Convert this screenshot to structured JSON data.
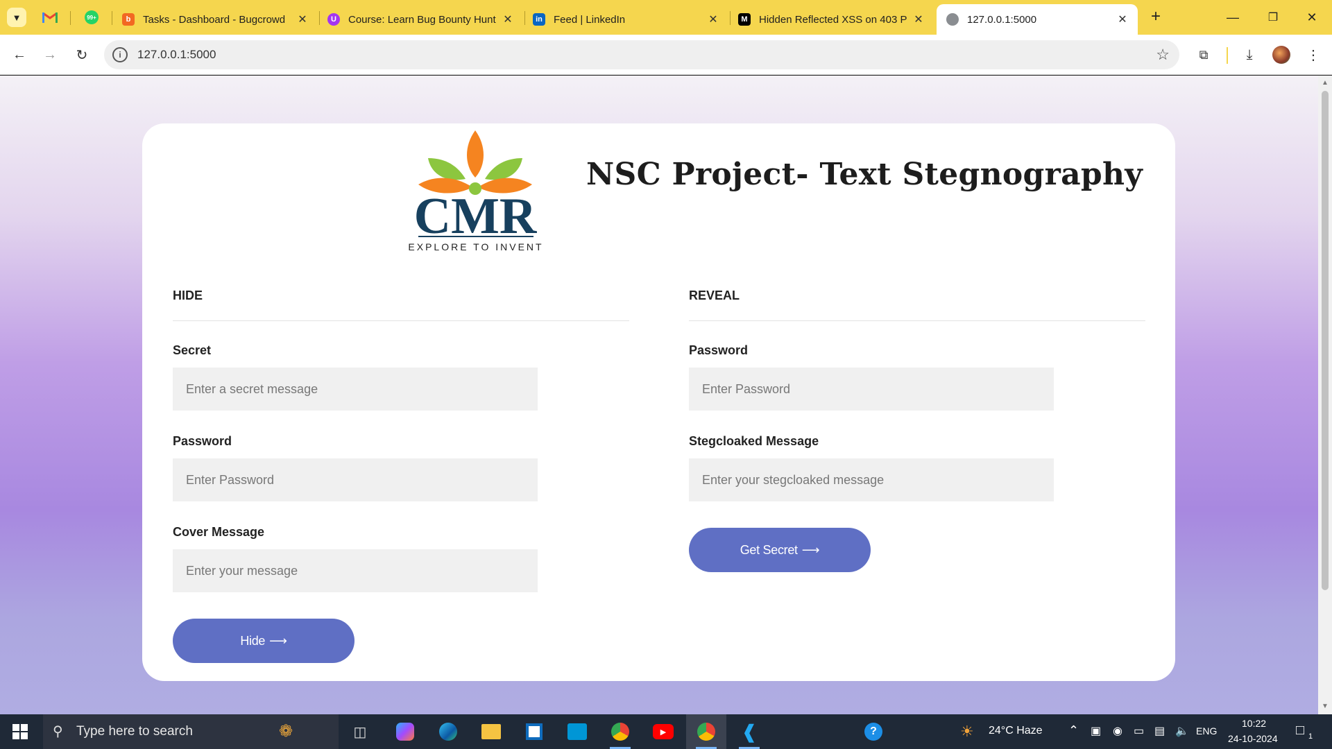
{
  "browser": {
    "tabs": [
      {
        "title": "Tasks - Dashboard - Bugcrowd",
        "favicon": "bugcrowd-icon",
        "color": "#f26822"
      },
      {
        "title": "Course: Learn Bug Bounty Hunt",
        "favicon": "udemy-icon",
        "color": "#a435f0"
      },
      {
        "title": "Feed | LinkedIn",
        "favicon": "linkedin-icon",
        "color": "#0a66c2"
      },
      {
        "title": "Hidden Reflected XSS on 403 P",
        "favicon": "medium-icon",
        "color": "#000000"
      },
      {
        "title": "127.0.0.1:5000",
        "favicon": "globe-icon",
        "color": "#5f6368"
      }
    ],
    "pinned": [
      {
        "name": "gmail-icon",
        "badge": ""
      },
      {
        "name": "whatsapp-icon",
        "badge": "99+"
      }
    ],
    "address": "127.0.0.1:5000",
    "accent_color": "#f5d64e"
  },
  "page": {
    "logo": {
      "letters": "CMR",
      "tagline": "EXPLORE TO INVENT"
    },
    "title": "NSC Project- Text Stegnography",
    "hide": {
      "heading": "HIDE",
      "secret_label": "Secret",
      "secret_placeholder": "Enter a secret message",
      "password_label": "Password",
      "password_placeholder": "Enter Password",
      "cover_label": "Cover Message",
      "cover_placeholder": "Enter your message",
      "button_label": "Hide"
    },
    "reveal": {
      "heading": "REVEAL",
      "password_label": "Password",
      "password_placeholder": "Enter Password",
      "stego_label": "Stegcloaked Message",
      "stego_placeholder": "Enter your stegcloaked message",
      "button_label": "Get Secret"
    },
    "button_color": "#5f6fc4"
  },
  "taskbar": {
    "search_placeholder": "Type here to search",
    "weather": "24°C  Haze",
    "language": "ENG",
    "time": "10:22",
    "date": "24-10-2024",
    "notification_count": "1"
  }
}
